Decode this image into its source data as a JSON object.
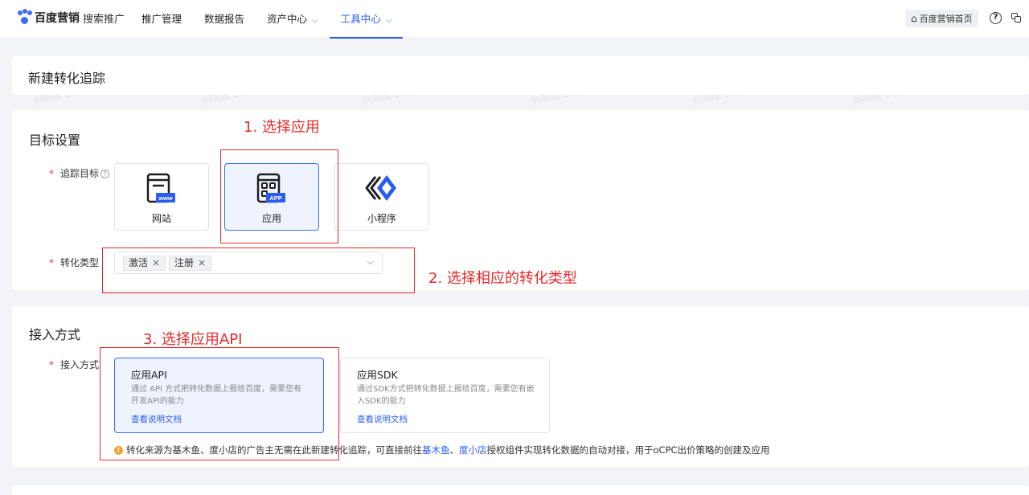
{
  "topbar": {
    "brand_name": "百度营销",
    "brand_sub": "搜索推广",
    "nav": [
      "推广管理",
      "数据报告",
      "资产中心",
      "工具中心"
    ],
    "home_label": "百度营销首页"
  },
  "page_title": "新建转化追踪",
  "target_section": {
    "title": "目标设置",
    "track_label": "追踪目标",
    "targets": [
      {
        "label": "网站",
        "badge": "www",
        "selected": false
      },
      {
        "label": "应用",
        "badge": "APP",
        "selected": true
      },
      {
        "label": "小程序",
        "selected": false
      }
    ],
    "conv_label": "转化类型",
    "tags": [
      "激活",
      "注册"
    ]
  },
  "access_section": {
    "title": "接入方式",
    "label": "接入方式",
    "methods": [
      {
        "title": "应用API",
        "desc": "通过 API 方式把转化数据上报给百度，需要您有开发API的能力",
        "link": "查看说明文档",
        "selected": true
      },
      {
        "title": "应用SDK",
        "desc": "通过SDK方式把转化数据上报给百度，需要您有嵌入SDK的能力",
        "link": "查看说明文档",
        "selected": false
      }
    ],
    "notice": {
      "pre": "转化来源为基木鱼、度小店的广告主无需在此新建转化追踪，可直接前往",
      "link1": "基木鱼",
      "sep": "、",
      "link2": "度小店",
      "post": "授权组件实现转化数据的自动对接，用于oCPC出价策略的创建及应用"
    }
  },
  "annotations": [
    "1. 选择应用",
    "2. 选择相应的转化类型",
    "3. 选择应用API"
  ],
  "watermark": "刘明瑶 1452",
  "colors": {
    "primary": "#2b5cf0",
    "annotation": "#e52a2a",
    "required": "#e8393a",
    "warning": "#f7a12a"
  }
}
